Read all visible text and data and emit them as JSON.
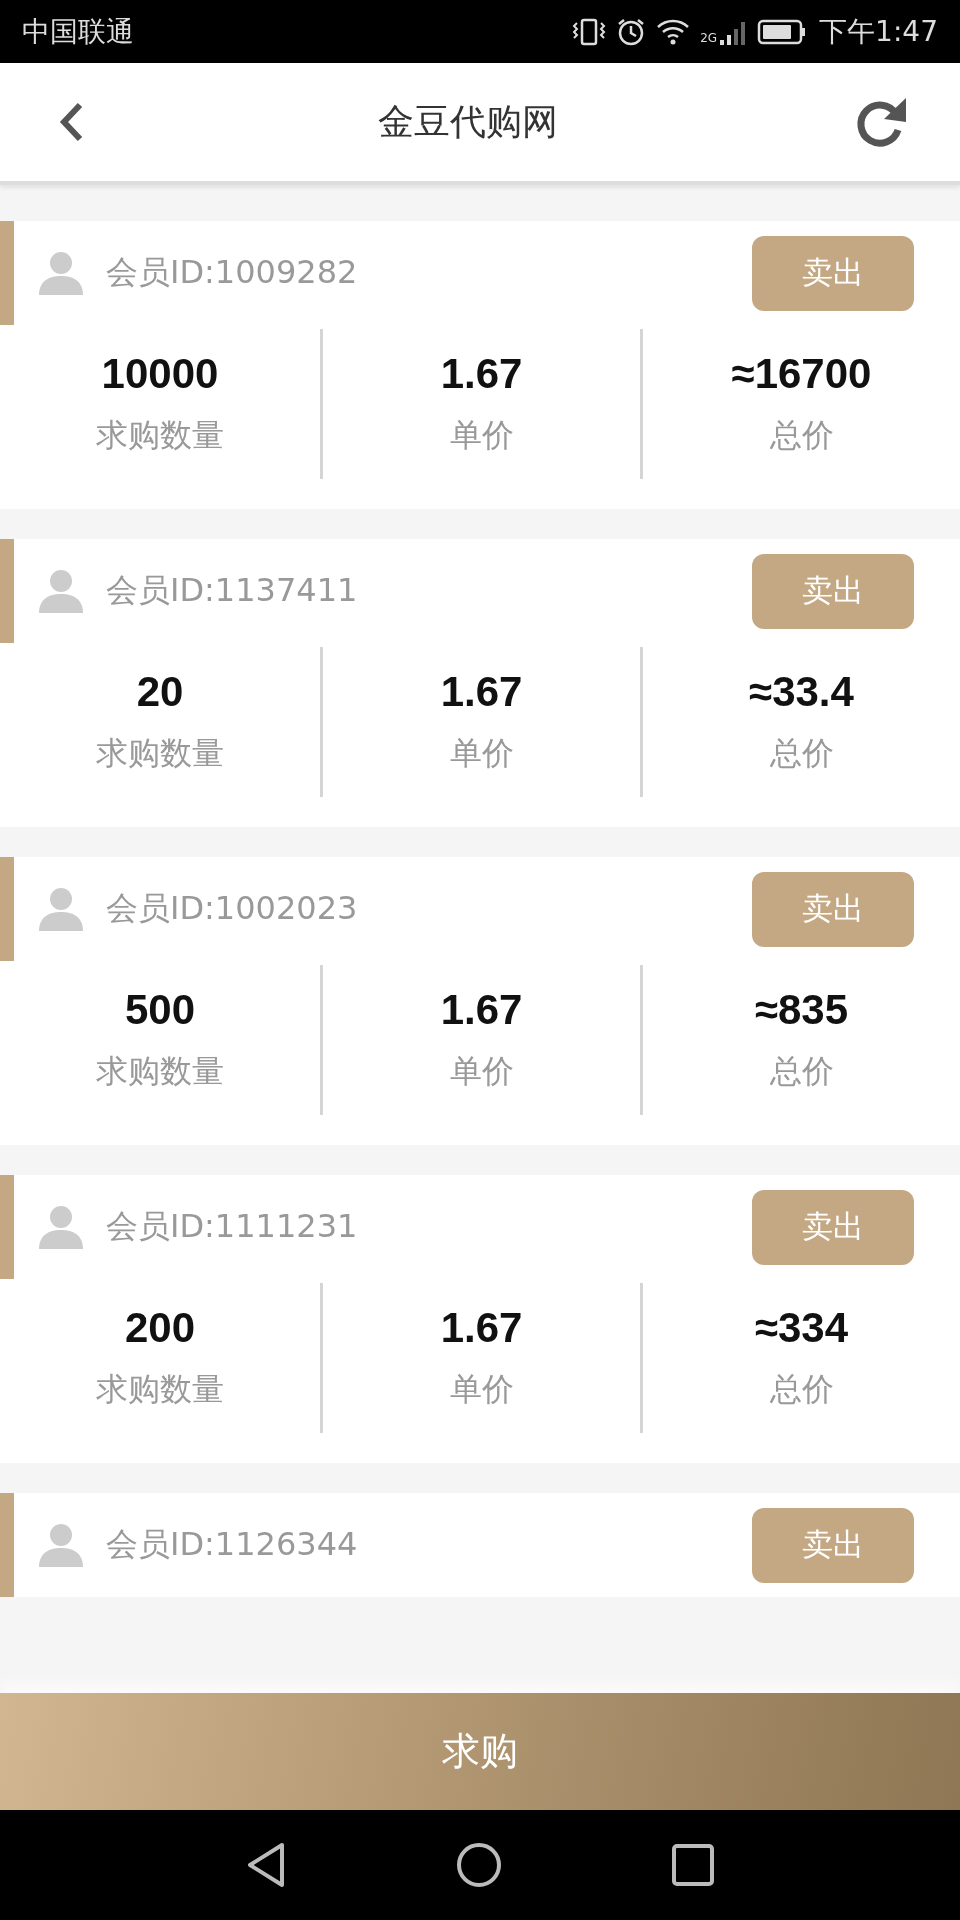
{
  "status_bar": {
    "carrier": "中国联通",
    "network": "2G",
    "time": "下午1:47"
  },
  "header": {
    "title": "金豆代购网"
  },
  "orders": [
    {
      "member": "会员ID:1009282",
      "button": "卖出",
      "stats": [
        {
          "value": "10000",
          "label": "求购数量"
        },
        {
          "value": "1.67",
          "label": "单价"
        },
        {
          "value": "≈16700",
          "label": "总价"
        }
      ]
    },
    {
      "member": "会员ID:1137411",
      "button": "卖出",
      "stats": [
        {
          "value": "20",
          "label": "求购数量"
        },
        {
          "value": "1.67",
          "label": "单价"
        },
        {
          "value": "≈33.4",
          "label": "总价"
        }
      ]
    },
    {
      "member": "会员ID:1002023",
      "button": "卖出",
      "stats": [
        {
          "value": "500",
          "label": "求购数量"
        },
        {
          "value": "1.67",
          "label": "单价"
        },
        {
          "value": "≈835",
          "label": "总价"
        }
      ]
    },
    {
      "member": "会员ID:1111231",
      "button": "卖出",
      "stats": [
        {
          "value": "200",
          "label": "求购数量"
        },
        {
          "value": "1.67",
          "label": "单价"
        },
        {
          "value": "≈334",
          "label": "总价"
        }
      ]
    },
    {
      "member": "会员ID:1126344",
      "button": "卖出"
    }
  ],
  "buy_button": "求购"
}
